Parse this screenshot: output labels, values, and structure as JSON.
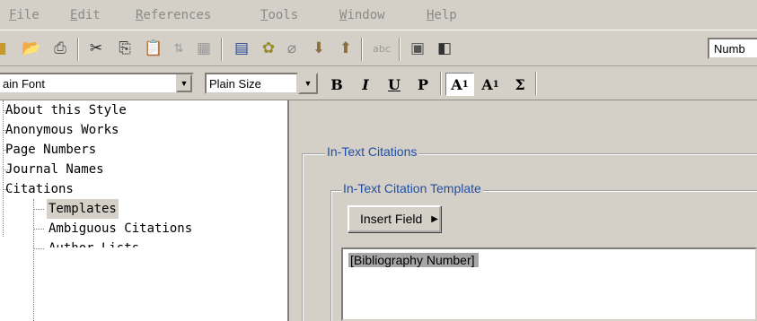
{
  "menubar": {
    "items": [
      {
        "label": "File",
        "accel": "F"
      },
      {
        "label": "Edit",
        "accel": "E"
      },
      {
        "label": "References",
        "accel": "R"
      },
      {
        "label": "Tools",
        "accel": "T"
      },
      {
        "label": "Window",
        "accel": "W"
      },
      {
        "label": "Help",
        "accel": "H"
      }
    ]
  },
  "toolbar1": {
    "icons": [
      "new-icon",
      "open-folder-icon",
      "print-icon",
      "cut-icon",
      "copy-icon",
      "paste-icon",
      "sort-icon",
      "clear-icon",
      "window-icon",
      "globe-icon",
      "paperclip-icon",
      "import-icon",
      "export-icon",
      "spellcheck-icon",
      "image-icon",
      "panel-icon"
    ],
    "combo_value": "Numb"
  },
  "toolbar2": {
    "font_value": "ain Font",
    "size_value": "Plain Size",
    "bold": "B",
    "italic": "I",
    "underline": "U",
    "plain": "P",
    "superscript_base": "A",
    "superscript_mark": "1",
    "subscript_base": "A",
    "subscript_mark": "1",
    "symbol": "Σ"
  },
  "tree": {
    "items": [
      {
        "label": "About this Style"
      },
      {
        "label": "Anonymous Works"
      },
      {
        "label": "Page Numbers"
      },
      {
        "label": "Journal Names"
      },
      {
        "label": "Citations"
      },
      {
        "label": "Templates"
      },
      {
        "label": "Ambiguous Citations"
      },
      {
        "label": "Author Lists"
      }
    ]
  },
  "main": {
    "group_title": "In-Text Citations",
    "subgroup_title": "In-Text Citation Template",
    "insert_button": "Insert Field",
    "template_text": "Bibliography Number"
  }
}
